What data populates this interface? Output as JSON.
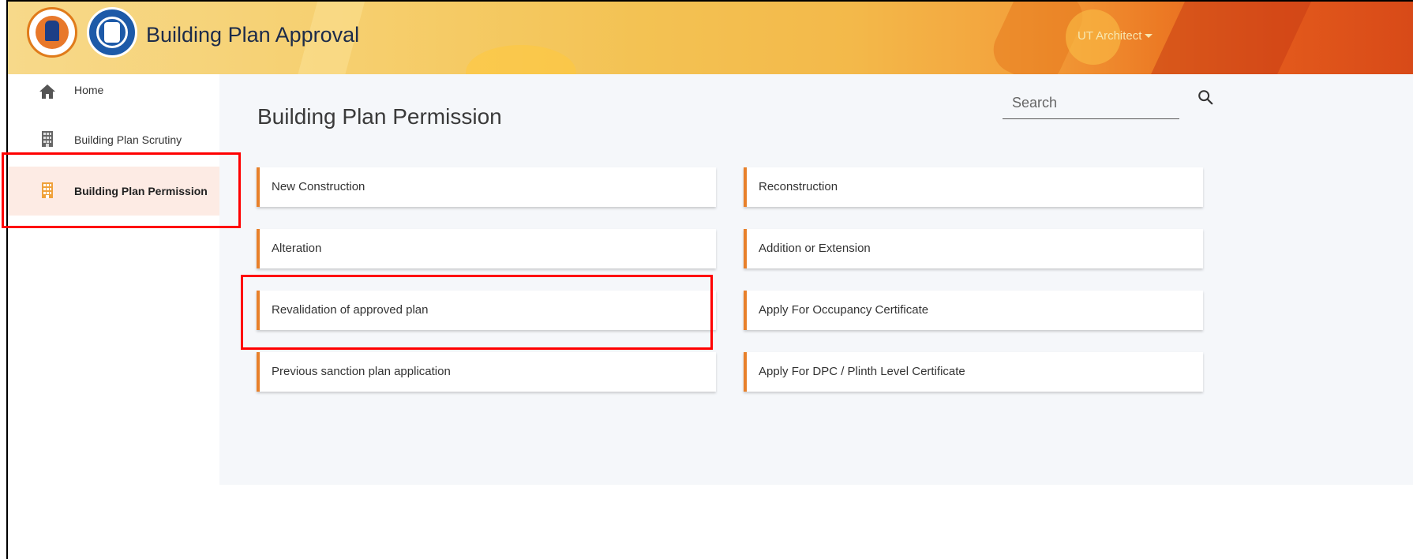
{
  "header": {
    "title": "Building Plan Approval",
    "user_menu": "UT Architect",
    "logos": [
      "chandigarh-administration-logo",
      "municipal-corporation-chandigarh-logo"
    ]
  },
  "sidebar": {
    "items": [
      {
        "label": "Home",
        "icon": "home-icon"
      },
      {
        "label": "Building Plan Scrutiny",
        "icon": "building-icon"
      },
      {
        "label": "Building Plan Permission",
        "icon": "building-icon",
        "active": true
      }
    ]
  },
  "main": {
    "title": "Building Plan Permission",
    "search": {
      "placeholder": "Search"
    },
    "options": [
      {
        "label": "New Construction"
      },
      {
        "label": "Reconstruction"
      },
      {
        "label": "Alteration"
      },
      {
        "label": "Addition or Extension"
      },
      {
        "label": "Revalidation of approved plan"
      },
      {
        "label": "Apply For Occupancy Certificate"
      },
      {
        "label": "Previous sanction plan application"
      },
      {
        "label": "Apply For DPC / Plinth Level Certificate"
      }
    ]
  },
  "colors": {
    "accent": "#e8802a",
    "active_bg": "#fdebe4",
    "highlight": "#ff0000"
  }
}
